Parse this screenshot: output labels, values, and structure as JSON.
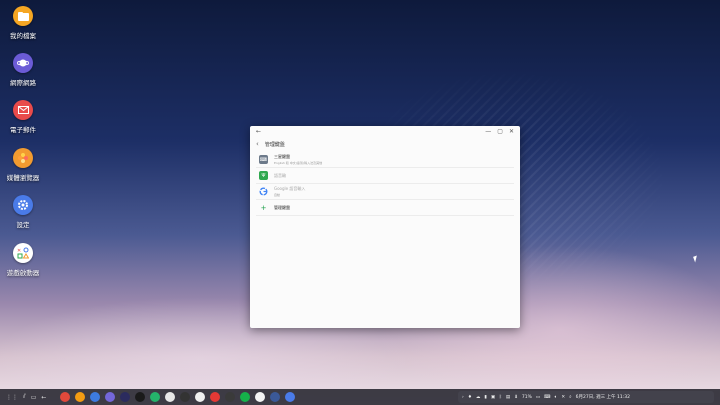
{
  "desktop": {
    "items": [
      {
        "label": "我的檔案",
        "icon": "folder-icon",
        "color": "#f5a623"
      },
      {
        "label": "網際網路",
        "icon": "internet-planet-icon",
        "color": "#6b5bd6"
      },
      {
        "label": "電子郵件",
        "icon": "email-icon",
        "color": "#e94b4b"
      },
      {
        "label": "媒體瀏覽器",
        "icon": "media-flower-icon",
        "color": "#f29b30"
      },
      {
        "label": "設定",
        "icon": "gear-icon",
        "color": "#4a7be8"
      },
      {
        "label": "遊戲啟動器",
        "icon": "game-launcher-icon",
        "color": "#ffffff"
      }
    ]
  },
  "window": {
    "title_back": "←",
    "buttons": [
      "—",
      "▢",
      "✕"
    ],
    "header_title": "管理鍵盤",
    "rows": [
      {
        "title": "三星鍵盤",
        "subtitle": "English 和 中文(臺灣)輸入法及其他",
        "icon": "keyboard-icon",
        "color": "#6d7a8a",
        "dim": false
      },
      {
        "title": "語音輸",
        "subtitle": "",
        "icon": "voice-input-icon",
        "color": "#2fa84f",
        "dim": true
      },
      {
        "title": "Google 語音輸入",
        "subtitle": "自動",
        "icon": "google-icon",
        "color": "#ffffff",
        "dim": true
      }
    ],
    "add_label": "管理鍵盤"
  },
  "taskbar": {
    "apps": [
      {
        "name": "chrome-app-icon",
        "color": "#e0493b"
      },
      {
        "name": "notes-app-icon",
        "color": "#f39c12"
      },
      {
        "name": "gallery-app-icon",
        "color": "#3d7be0"
      },
      {
        "name": "internet-app-icon",
        "color": "#7467d9"
      },
      {
        "name": "apps-app-icon",
        "color": "#2b2b5e"
      },
      {
        "name": "video-app-icon",
        "color": "#1a1a1a"
      },
      {
        "name": "play-store-app-icon",
        "color": "#25b36b"
      },
      {
        "name": "store-app-icon",
        "color": "#e8e8e8"
      },
      {
        "name": "dark-app-icon",
        "color": "#333333"
      },
      {
        "name": "clock-app-icon",
        "color": "#f0f0f0"
      },
      {
        "name": "camera-app-icon",
        "color": "#e53935"
      },
      {
        "name": "photos-app-icon",
        "color": "#3a3a3a"
      },
      {
        "name": "line-app-icon",
        "color": "#16b24a"
      },
      {
        "name": "mail-app-icon",
        "color": "#f4f4f4"
      },
      {
        "name": "facebook-app-icon",
        "color": "#3b5998"
      },
      {
        "name": "settings-app-icon",
        "color": "#4a7be8"
      }
    ],
    "battery": "71%",
    "datetime": "6月27日, 週三 上午 11:32"
  }
}
